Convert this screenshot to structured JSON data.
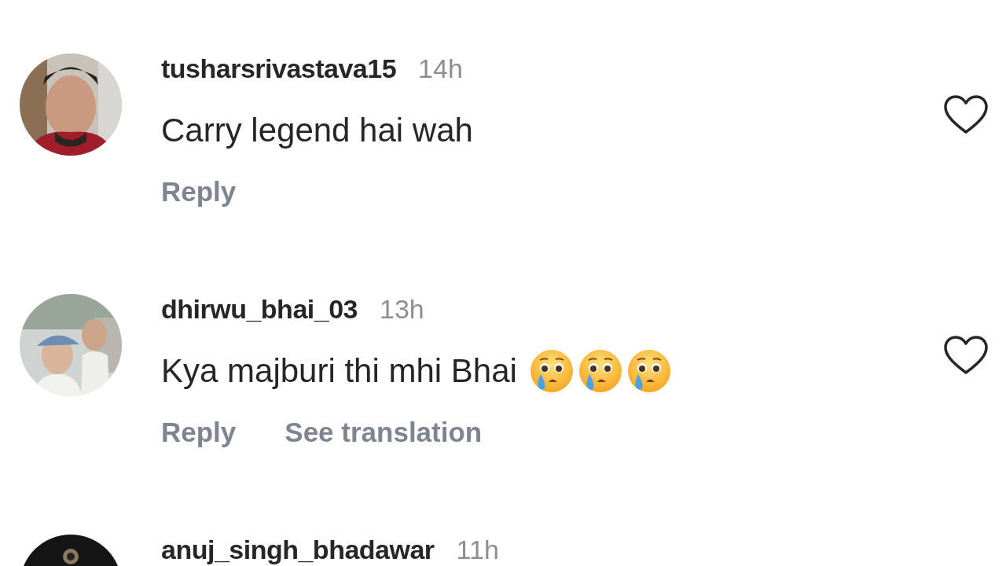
{
  "comments": [
    {
      "username": "tusharsrivastava15",
      "time": "14h",
      "text": "Carry legend hai wah",
      "actions": [
        "Reply"
      ],
      "liked": false
    },
    {
      "username": "dhirwu_bhai_03",
      "time": "13h",
      "text": "Kya majburi thi mhi Bhai",
      "emojis": [
        {
          "kind": "tear"
        },
        {
          "kind": "tear"
        },
        {
          "kind": "tear"
        }
      ],
      "actions": [
        "Reply",
        "See translation"
      ],
      "liked": false
    },
    {
      "username": "anuj_singh_bhadawar",
      "time": "11h"
    }
  ]
}
